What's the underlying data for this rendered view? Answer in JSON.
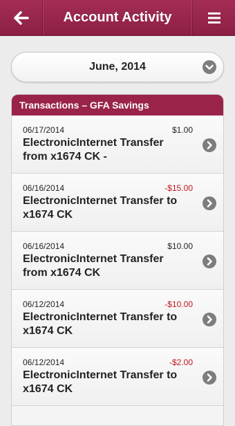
{
  "header": {
    "title": "Account Activity",
    "back_icon": "back-arrow-icon",
    "menu_icon": "hamburger-menu-icon",
    "bar_color": "#9a2449"
  },
  "month_selector": {
    "value": "June, 2014",
    "icon": "chevron-down-icon"
  },
  "transactions": {
    "header": "Transactions – GFA Savings",
    "items": [
      {
        "date": "06/17/2014",
        "amount": "$1.00",
        "description": "ElectronicInternet Transfer from x1674 CK -"
      },
      {
        "date": "06/16/2014",
        "amount": "-$15.00",
        "description": "ElectronicInternet Transfer to x1674 CK"
      },
      {
        "date": "06/16/2014",
        "amount": "$10.00",
        "description": "ElectronicInternet Transfer from x1674 CK"
      },
      {
        "date": "06/12/2014",
        "amount": "-$10.00",
        "description": "ElectronicInternet Transfer to x1674 CK"
      },
      {
        "date": "06/12/2014",
        "amount": "-$2.00",
        "description": "ElectronicInternet Transfer to x1674 CK"
      }
    ]
  },
  "colors": {
    "negative_amount": "#c0161b",
    "accent": "#9a2449"
  }
}
